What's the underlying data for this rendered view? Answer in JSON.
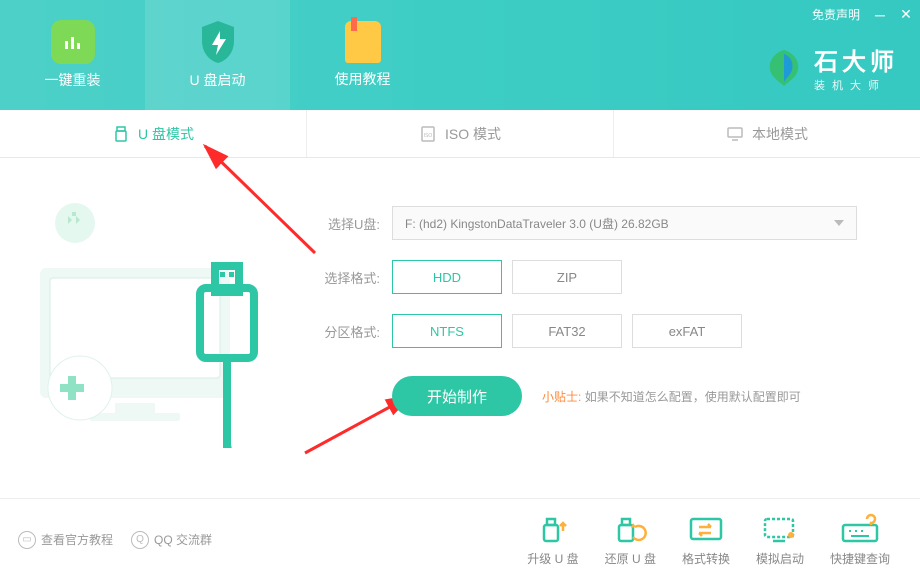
{
  "window": {
    "disclaimer": "免责声明",
    "brand_title": "石大师",
    "brand_sub": "装机大师"
  },
  "nav": [
    {
      "label": "一键重装"
    },
    {
      "label": "U 盘启动"
    },
    {
      "label": "使用教程"
    }
  ],
  "modes": [
    {
      "label": "U 盘模式"
    },
    {
      "label": "ISO 模式"
    },
    {
      "label": "本地模式"
    }
  ],
  "form": {
    "select_disk_label": "选择U盘:",
    "select_disk_value": "F: (hd2) KingstonDataTraveler 3.0 (U盘) 26.82GB",
    "select_format_label": "选择格式:",
    "format_options": [
      "HDD",
      "ZIP"
    ],
    "format_selected": "HDD",
    "partition_label": "分区格式:",
    "partition_options": [
      "NTFS",
      "FAT32",
      "exFAT"
    ],
    "partition_selected": "NTFS",
    "start_label": "开始制作",
    "tip_label": "小贴士:",
    "tip_text": "如果不知道怎么配置，使用默认配置即可"
  },
  "footer_links": [
    {
      "label": "查看官方教程"
    },
    {
      "label": "QQ 交流群"
    }
  ],
  "tools": [
    {
      "label": "升级 U 盘"
    },
    {
      "label": "还原 U 盘"
    },
    {
      "label": "格式转换"
    },
    {
      "label": "模拟启动"
    },
    {
      "label": "快捷键查询"
    }
  ]
}
